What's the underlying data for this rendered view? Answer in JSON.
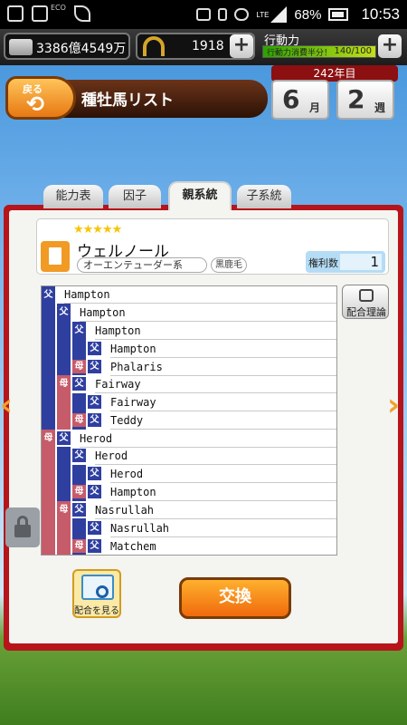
{
  "status_bar": {
    "eco": "ECO",
    "network": "LTE",
    "battery": "68%",
    "time": "10:53"
  },
  "header": {
    "money": "3386億4549万",
    "horseshoes": "1918",
    "action_power": {
      "title": "行動力",
      "cost_label": "行動力消費半分！",
      "value": "140/100",
      "fill_fraction": 1.0
    }
  },
  "title_bar": {
    "back_label": "戻る",
    "back_arrow": "⟲",
    "title": "種牡馬リスト"
  },
  "calendar": {
    "year_label": "242年目",
    "month_value": "6",
    "month_unit": "月",
    "week_value": "2",
    "week_unit": "週"
  },
  "tabs": [
    {
      "label": "能力表",
      "active": false
    },
    {
      "label": "因子",
      "active": false
    },
    {
      "label": "親系統",
      "active": true
    },
    {
      "label": "子系統",
      "active": false
    }
  ],
  "horse": {
    "stars": "★★★★★",
    "name": "ウェルノール",
    "lineage": "オーエンテューダー系",
    "coat": "黒鹿毛",
    "rights_label": "権利数",
    "rights_value": "1"
  },
  "pedigree_tags": {
    "sire": "父",
    "dam": "母"
  },
  "pedigree": [
    {
      "name": "Hampton"
    },
    {
      "name": "Hampton"
    },
    {
      "name": "Hampton"
    },
    {
      "name": "Hampton"
    },
    {
      "name": "Phalaris"
    },
    {
      "name": "Fairway"
    },
    {
      "name": "Fairway"
    },
    {
      "name": "Teddy"
    },
    {
      "name": "Herod"
    },
    {
      "name": "Herod"
    },
    {
      "name": "Herod"
    },
    {
      "name": "Hampton"
    },
    {
      "name": "Nasrullah"
    },
    {
      "name": "Nasrullah"
    },
    {
      "name": "Matchem"
    }
  ],
  "buttons": {
    "mating_theory": "配合理論",
    "view_mating": "配合を見る",
    "exchange": "交換",
    "prev_arrow": "‹",
    "next_arrow": "›"
  }
}
